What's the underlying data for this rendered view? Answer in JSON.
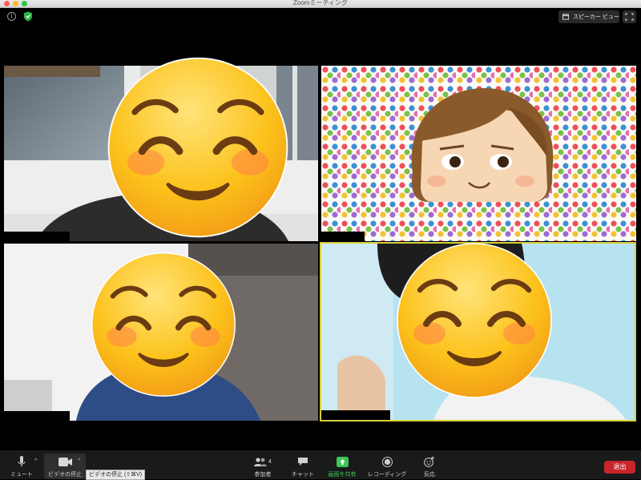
{
  "window": {
    "title": "Zoomミーティング"
  },
  "top": {
    "view_label": "スピーカー ビュー"
  },
  "participants": [
    {
      "name": "",
      "emoji": "smiling-face-with-smiling-eyes"
    },
    {
      "name": "",
      "emoji": "cartoon-avatar"
    },
    {
      "name": "",
      "emoji": "smiling-face-with-smiling-eyes"
    },
    {
      "name": "",
      "emoji": "smiling-face-with-smiling-eyes"
    }
  ],
  "toolbar": {
    "mute_label": "ミュート",
    "video_label": "ビデオの停止",
    "video_tooltip": "ビデオの停止 (⇧⌘V)",
    "participants_label": "参加者",
    "participants_count": "4",
    "chat_label": "チャット",
    "share_label": "画面を共有",
    "record_label": "レコーディング",
    "reactions_label": "反応",
    "leave_label": "退出"
  },
  "colors": {
    "share_green": "#3ec457",
    "leave_red": "#c8262a",
    "active_border": "#d7d13a"
  }
}
